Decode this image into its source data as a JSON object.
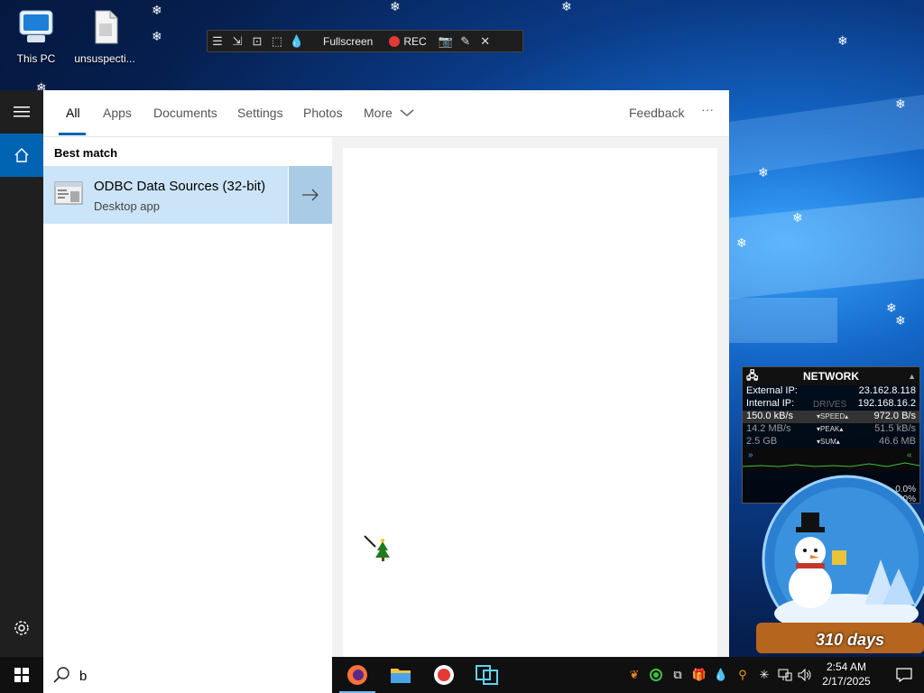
{
  "desktop": {
    "icons": [
      {
        "label": "This PC",
        "icon": "computer-icon"
      },
      {
        "label": "unsuspecti...",
        "icon": "file-icon"
      }
    ]
  },
  "recorder": {
    "fullscreen_label": "Fullscreen",
    "rec_label": "REC",
    "rec_color": "#e53935"
  },
  "search": {
    "tabs": [
      {
        "label": "All",
        "active": true
      },
      {
        "label": "Apps"
      },
      {
        "label": "Documents"
      },
      {
        "label": "Settings"
      },
      {
        "label": "Photos"
      },
      {
        "label": "More"
      }
    ],
    "feedback_label": "Feedback",
    "more_options_label": "···",
    "section_title": "Best match",
    "best_match": {
      "title": "ODBC Data Sources (32-bit)",
      "subtitle": "Desktop app"
    },
    "query": "b",
    "accent": "#0063b1"
  },
  "network_gadget": {
    "title": "NETWORK",
    "external_ip_label": "External IP:",
    "external_ip": "23.162.8.118",
    "internal_ip_label": "Internal IP:",
    "internal_ip": "192.168.16.2",
    "overlay_label": "DRIVES",
    "speed_down": "150.0 kB/s",
    "speed_label": "SPEED",
    "speed_up": "972.0 B/s",
    "peak_down": "14.2 MB/s",
    "peak_label": "PEAK",
    "peak_up": "51.5 kB/s",
    "sum_down": "2.5 GB",
    "sum_label": "SUM",
    "sum_up": "46.6 MB",
    "pct_1": "0.0%",
    "pct_2": "0.0%"
  },
  "snow_globe": {
    "days_label": "310 days"
  },
  "taskbar": {
    "apps": [
      "firefox-icon",
      "file-explorer-icon",
      "screen-recorder-icon",
      "vmware-icon"
    ],
    "time": "2:54 AM",
    "date": "2/17/2025"
  }
}
